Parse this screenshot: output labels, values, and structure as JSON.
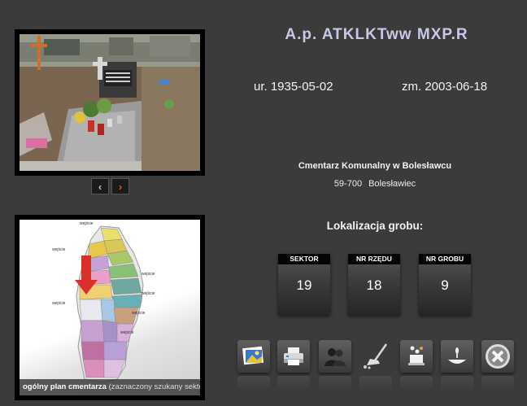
{
  "person": {
    "name": "A.p. ATKLKTww MXP.R",
    "born": "ur. 1935-05-02",
    "died": "zm. 2003-06-18"
  },
  "cemetery": {
    "name": "Cmentarz Komunalny w Bolesławcu",
    "postal_code": "59-700",
    "city": "Bolesławiec"
  },
  "location": {
    "title": "Lokalizacja grobu:",
    "fields": [
      {
        "label": "SEKTOR",
        "value": "19"
      },
      {
        "label": "NR RZĘDU",
        "value": "18"
      },
      {
        "label": "NR GROBU",
        "value": "9"
      }
    ]
  },
  "map": {
    "caption_bold": "ogólny plan cmentarza",
    "caption_note": "(zaznaczony szukany sektor)",
    "entrance_label": "wejście"
  },
  "photo_nav": {
    "prev": "‹",
    "next": "›"
  },
  "toolbar_icons": [
    "photo-gallery-icon",
    "print-icon",
    "people-icon",
    "broom-icon",
    "candles-icon",
    "candle-icon",
    "close-icon"
  ],
  "colors": {
    "background": "#3b3b3b",
    "next_arrow": "#e8552c",
    "marker": "#d9312a"
  }
}
